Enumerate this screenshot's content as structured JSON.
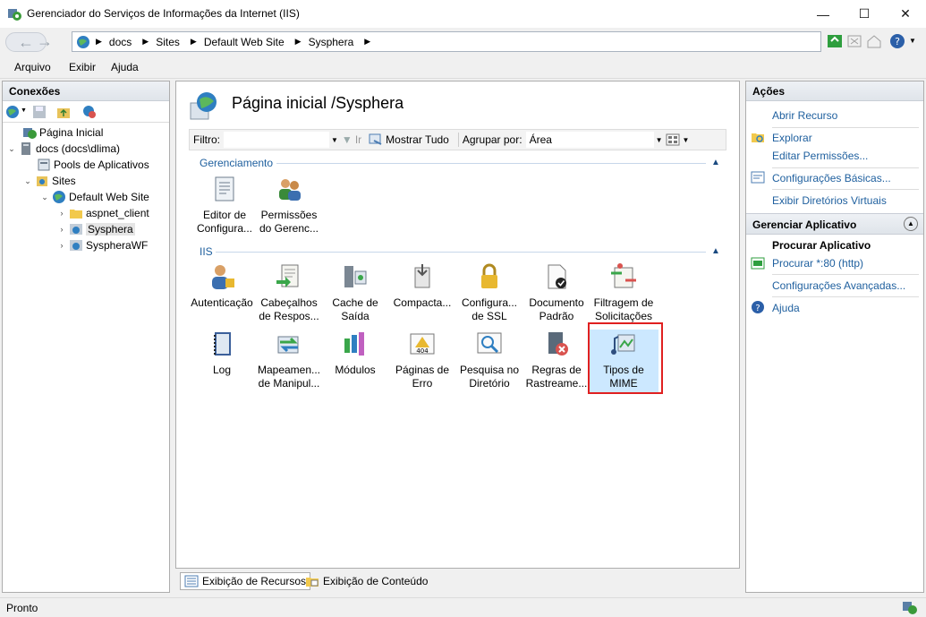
{
  "window": {
    "title": "Gerenciador do Serviços de Informações da Internet (IIS)",
    "controls": {
      "minimize": "—",
      "maximize": "☐",
      "close": "✕"
    }
  },
  "address": {
    "crumbs": [
      "docs",
      "Sites",
      "Default Web Site",
      "Sysphera"
    ]
  },
  "menu": {
    "items": [
      "Arquivo",
      "Exibir",
      "Ajuda"
    ]
  },
  "connections": {
    "title": "Conexões",
    "tree": [
      {
        "label": "Página Inicial"
      },
      {
        "label": "docs (docs\\dlima)"
      },
      {
        "label": "Pools de Aplicativos"
      },
      {
        "label": "Sites"
      },
      {
        "label": "Default Web Site"
      },
      {
        "label": "aspnet_client"
      },
      {
        "label": "Sysphera"
      },
      {
        "label": "SyspheraWF"
      }
    ]
  },
  "center": {
    "title": "Página inicial /Sysphera",
    "filter": {
      "label": "Filtro:",
      "go": "Ir",
      "show_all": "Mostrar Tudo",
      "group_label": "Agrupar por:",
      "group_value": "Área"
    },
    "groups": {
      "management": "Gerenciamento",
      "iis": "IIS"
    },
    "management_features": [
      {
        "line1": "Editor de",
        "line2": "Configura..."
      },
      {
        "line1": "Permissões",
        "line2": "do Gerenc..."
      }
    ],
    "iis_row1": [
      {
        "line1": "Autenticação",
        "line2": ""
      },
      {
        "line1": "Cabeçalhos",
        "line2": "de Respos..."
      },
      {
        "line1": "Cache de",
        "line2": "Saída"
      },
      {
        "line1": "Compacta...",
        "line2": ""
      },
      {
        "line1": "Configura...",
        "line2": "de SSL"
      },
      {
        "line1": "Documento",
        "line2": "Padrão"
      },
      {
        "line1": "Filtragem de",
        "line2": "Solicitações"
      }
    ],
    "iis_row2": [
      {
        "line1": "Log",
        "line2": ""
      },
      {
        "line1": "Mapeamen...",
        "line2": "de Manipul..."
      },
      {
        "line1": "Módulos",
        "line2": ""
      },
      {
        "line1": "Páginas de",
        "line2": "Erro"
      },
      {
        "line1": "Pesquisa no",
        "line2": "Diretório"
      },
      {
        "line1": "Regras de",
        "line2": "Rastreame..."
      },
      {
        "line1": "Tipos de",
        "line2": "MIME"
      }
    ]
  },
  "view_tabs": {
    "features": "Exibição de Recursos",
    "content": "Exibição de Conteúdo"
  },
  "actions": {
    "title": "Ações",
    "open": "Abrir Recurso",
    "explore": "Explorar",
    "edit_perms": "Editar Permissões...",
    "basic": "Configurações Básicas...",
    "virtual_dirs": "Exibir Diretórios Virtuais",
    "manage_app": "Gerenciar Aplicativo",
    "browse_app": "Procurar Aplicativo",
    "browse_80": "Procurar *:80 (http)",
    "advanced": "Configurações Avançadas...",
    "help": "Ajuda"
  },
  "status": {
    "text": "Pronto"
  },
  "colors": {
    "accent_link": "#1e5f9e",
    "highlight_red": "#e02020",
    "selection": "#cce8ff"
  }
}
